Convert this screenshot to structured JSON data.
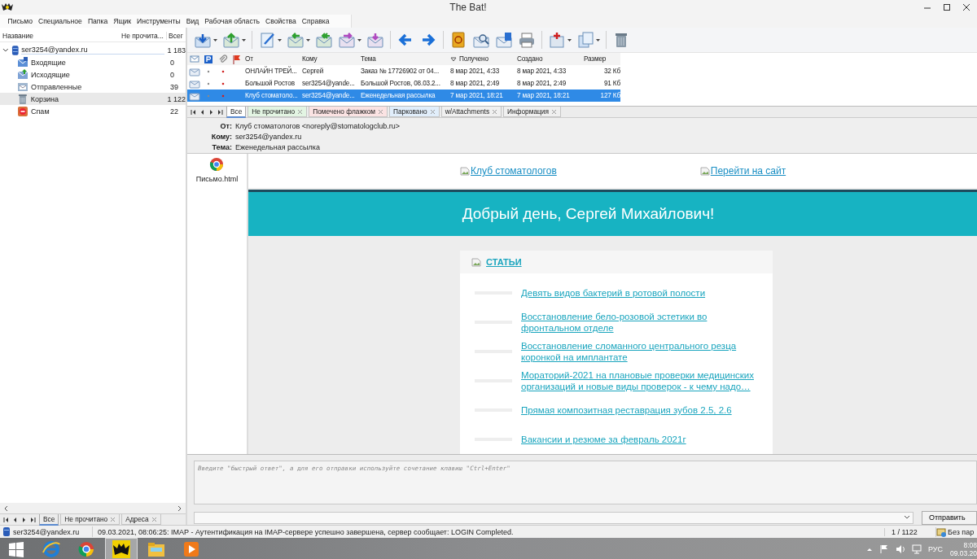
{
  "window": {
    "title": "The Bat!"
  },
  "menu": [
    "Письмо",
    "Специальное",
    "Папка",
    "Ящик",
    "Инструменты",
    "Вид",
    "Рабочая область",
    "Свойства",
    "Справка"
  ],
  "folder_pane": {
    "columns": [
      "Название",
      "Не прочита...",
      "Всег"
    ],
    "accounts": [
      {
        "name": "ser3254@yandex.ru",
        "total": "1 183",
        "expanded": true,
        "children": [
          {
            "name": "Входящие",
            "total": "0",
            "kind": "inbox",
            "selected": false
          },
          {
            "name": "Исходящие",
            "total": "0",
            "kind": "outbox",
            "selected": false
          },
          {
            "name": "Отправленные",
            "total": "39",
            "kind": "sent",
            "selected": false
          },
          {
            "name": "Корзина",
            "total": "1 122",
            "kind": "trash",
            "selected": true
          },
          {
            "name": "Спам",
            "total": "22",
            "kind": "spam",
            "selected": false
          }
        ]
      }
    ],
    "tabs": [
      {
        "label": "Все",
        "selected": true,
        "closable": false
      },
      {
        "label": "Не прочитано",
        "selected": false,
        "closable": true
      },
      {
        "label": "Адреса",
        "selected": false,
        "closable": true
      }
    ]
  },
  "message_list": {
    "columns": [
      {
        "label": "От",
        "sorted": false
      },
      {
        "label": "Кому",
        "sorted": false
      },
      {
        "label": "Тема",
        "sorted": false
      },
      {
        "label": "Получено",
        "sorted": true
      },
      {
        "label": "Создано",
        "sorted": false
      },
      {
        "label": "Размер",
        "sorted": false
      }
    ],
    "rows": [
      {
        "from": "ОНЛАЙН ТРЕЙ...",
        "to": "Сергей",
        "subject": "Заказ № 17726902 от 04...",
        "received": "8 мар 2021, 4:33",
        "created": "8 мар 2021, 4:33",
        "size": "32 Кб",
        "selected": false
      },
      {
        "from": "Большой Ростов",
        "to": "ser3254@yande...",
        "subject": "Большой Ростов, 08.03.2...",
        "received": "8 мар 2021, 2:49",
        "created": "8 мар 2021, 2:49",
        "size": "91 Кб",
        "selected": false
      },
      {
        "from": "Клуб стоматоло...",
        "to": "ser3254@yande...",
        "subject": "Еженедельная рассылка",
        "received": "7 мар 2021, 18:21",
        "created": "7 мар 2021, 18:21",
        "size": "127 Кб",
        "selected": true
      }
    ],
    "tabs": [
      {
        "label": "Все",
        "selected": true,
        "closable": false,
        "color": "#ffffff"
      },
      {
        "label": "Не прочитано",
        "selected": false,
        "closable": true,
        "color": "#e3f5e3"
      },
      {
        "label": "Помечено флажком",
        "selected": false,
        "closable": true,
        "color": "#fbe3e3"
      },
      {
        "label": "Парковано",
        "selected": false,
        "closable": true,
        "color": "#e1eefb"
      },
      {
        "label": "w/Attachments",
        "selected": false,
        "closable": true,
        "color": "#f0f0f0"
      },
      {
        "label": "Информация",
        "selected": false,
        "closable": true,
        "color": "#f0f0f0"
      }
    ]
  },
  "message_header": [
    {
      "label": "От:",
      "value": "Клуб стоматологов <noreply@stomatologclub.ru>"
    },
    {
      "label": "Кому:",
      "value": "ser3254@yandex.ru"
    },
    {
      "label": "Тема:",
      "value": "Еженедельная рассылка"
    }
  ],
  "attachments": [
    {
      "name": "Письмо.html"
    }
  ],
  "email": {
    "top_links": [
      "Клуб стоматологов",
      "Перейти на сайт"
    ],
    "greeting": "Добрый день, Сергей Михайлович!",
    "section_title": "СТАТЬИ",
    "articles": [
      "Девять видов бактерий в ротовой полости",
      "Восстановление бело-розовой эстетики во фронтальном отделе",
      "Восстановление сломанного центрального резца коронкой на имплантате",
      "Мораторий-2021 на плановые проверки медицинских организаций и новые виды проверок - к чему надо…",
      "Прямая композитная реставрация зубов 2.5, 2.6",
      "Вакансии и резюме за февраль 2021г"
    ]
  },
  "quick_reply": {
    "placeholder": "Введите \"быстрый ответ\", а для его отправки используйте сочетание клавиш \"Ctrl+Enter\"",
    "send_button": "Отправить"
  },
  "status_bar": {
    "account": "ser3254@yandex.ru",
    "message": "09.03.2021, 08:06:25: IMAP  - Аутентификация на IMAP-сервере успешно завершена, сервер сообщает: LOGIN Completed.",
    "count": "1 / 1122",
    "mode": "Без пар"
  },
  "taskbar": {
    "language": "РУС",
    "time": "8:08",
    "date": "09.03.20"
  }
}
